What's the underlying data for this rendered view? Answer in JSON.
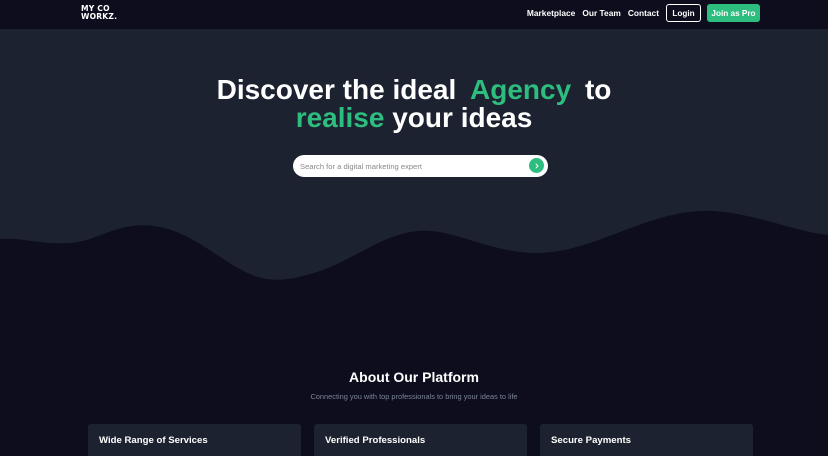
{
  "brand": {
    "logo_line1": "MY CO",
    "logo_line2": "WORKZ."
  },
  "nav": {
    "links": [
      "Marketplace",
      "Our Team",
      "Contact"
    ],
    "login_label": "Login",
    "join_label": "Join as Pro"
  },
  "hero": {
    "title_part1": "Discover the ideal",
    "title_accent1": "Agency",
    "title_part2": "to",
    "title_accent2": "realise",
    "title_part3": "your ideas",
    "search_placeholder": "Search for a digital marketing expert",
    "search_button_icon": "chevron-right-icon"
  },
  "about": {
    "title": "About Our Platform",
    "subtitle": "Connecting you with top professionals to bring your ideas to life",
    "cards": [
      {
        "title": "Wide Range of Services"
      },
      {
        "title": "Verified Professionals"
      },
      {
        "title": "Secure Payments"
      }
    ]
  },
  "colors": {
    "background": "#0d0d1e",
    "hero_background": "#1c2230",
    "accent": "#2dbd7e",
    "card_background": "#1c2230"
  }
}
